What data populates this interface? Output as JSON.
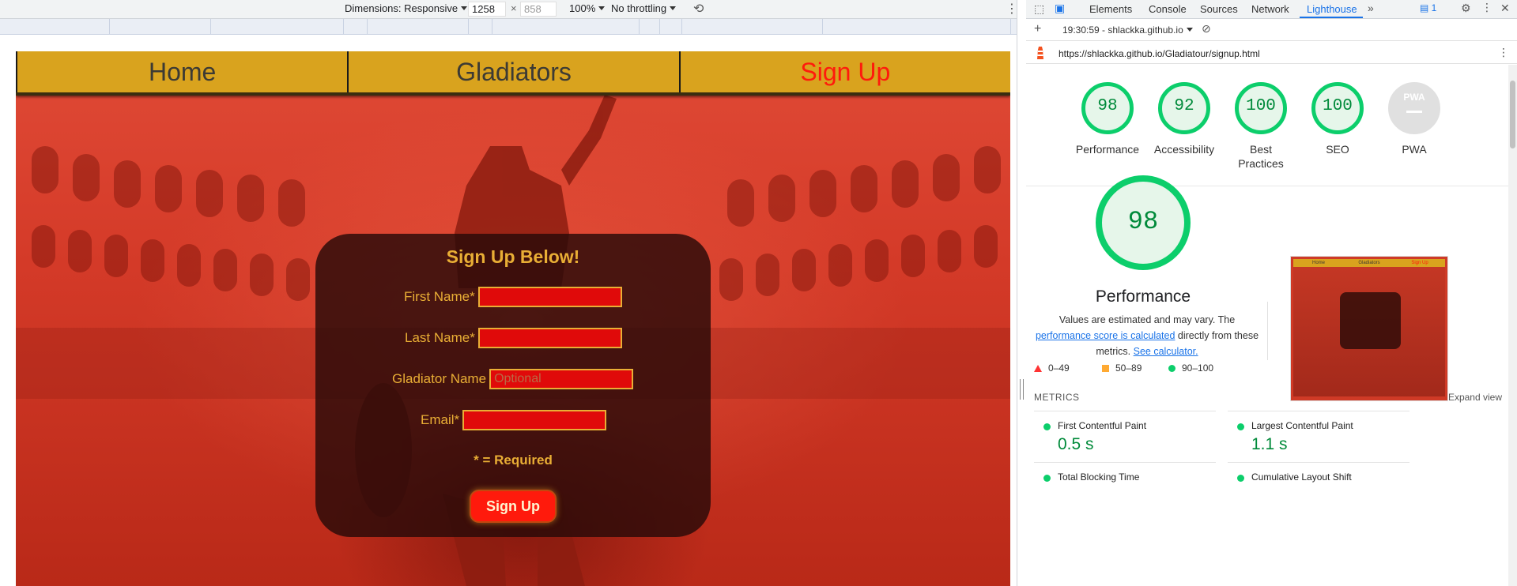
{
  "device_toolbar": {
    "dimensions_label": "Dimensions: Responsive",
    "width_value": "1258",
    "times": "×",
    "height_value": "858",
    "zoom": "100%",
    "throttling": "No throttling"
  },
  "site": {
    "nav": [
      "Home",
      "Gladiators",
      "Sign Up"
    ],
    "form": {
      "title": "Sign Up Below!",
      "fields": [
        {
          "label": "First Name*",
          "placeholder": ""
        },
        {
          "label": "Last Name*",
          "placeholder": ""
        },
        {
          "label": "Gladiator Name",
          "placeholder": "Optional"
        },
        {
          "label": "Email*",
          "placeholder": ""
        }
      ],
      "required_note": "* = Required",
      "submit": "Sign Up"
    }
  },
  "devtools": {
    "tabs": [
      "Elements",
      "Console",
      "Sources",
      "Network",
      "Lighthouse"
    ],
    "active_tab": "Lighthouse",
    "issues_count": "1",
    "report_selector": "19:30:59 - shlackka.github.io",
    "url": "https://shlackka.github.io/Gladiatour/signup.html",
    "scores": [
      {
        "label": "Performance",
        "value": "98"
      },
      {
        "label": "Accessibility",
        "value": "92"
      },
      {
        "label": "Best Practices",
        "value": "100"
      },
      {
        "label": "SEO",
        "value": "100"
      },
      {
        "label": "PWA",
        "value": "PWA"
      }
    ],
    "performance": {
      "score": "98",
      "title": "Performance",
      "note_before": "Values are estimated and may vary. The ",
      "note_link1": "performance score is calculated",
      "note_middle": " directly from these metrics. ",
      "note_link2": "See calculator.",
      "legend": [
        "0–49",
        "50–89",
        "90–100"
      ]
    },
    "thumbnail_nav": [
      "Home",
      "Gladiators",
      "Sign Up"
    ],
    "metrics_header": "METRICS",
    "expand_view": "Expand view",
    "metrics": [
      {
        "name": "First Contentful Paint",
        "value": "0.5 s"
      },
      {
        "name": "Largest Contentful Paint",
        "value": "1.1 s"
      },
      {
        "name": "Total Blocking Time",
        "value": ""
      },
      {
        "name": "Cumulative Layout Shift",
        "value": ""
      }
    ],
    "colors": {
      "pass": "#0cce6b",
      "average": "#ffaa33",
      "fail": "#ff3333",
      "accent": "#1a73e8"
    }
  }
}
